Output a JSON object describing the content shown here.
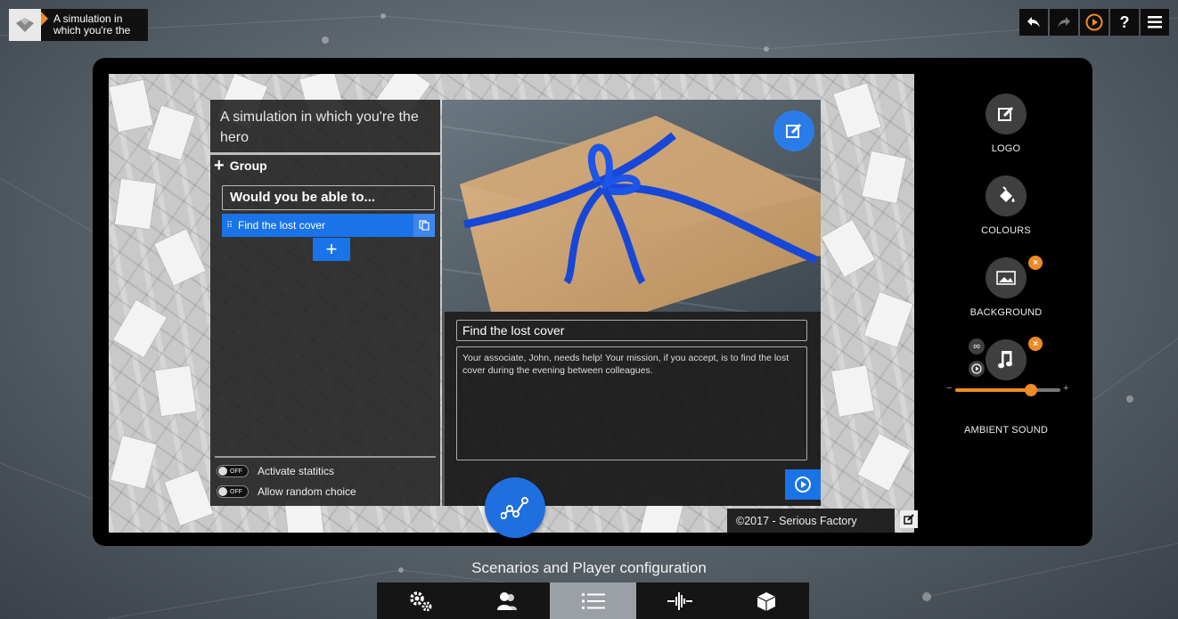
{
  "window": {
    "title": "A simulation in which you're the"
  },
  "toolbar": {
    "undo_icon": "undo-arrow-icon",
    "redo_icon": "redo-arrow-icon",
    "preview_icon": "play-circle-icon",
    "help_label": "?",
    "menu_icon": "hamburger-menu-icon"
  },
  "left_panel": {
    "title": "A simulation in which you're the hero",
    "group_button_label": "Group",
    "question_title": "Would you be able to...",
    "scenario_item_label": "Find the lost cover",
    "add_scenario_label": "+",
    "options": [
      {
        "toggle_text": "OFF",
        "label": "Activate statitics"
      },
      {
        "toggle_text": "OFF",
        "label": "Allow random choice"
      }
    ]
  },
  "content_panel": {
    "scenario_title": "Find the lost cover",
    "scenario_description": "Your associate, John, needs help! Your mission, if you accept, is to find the lost cover during the evening between colleagues."
  },
  "copyright": "©2017 - Serious Factory",
  "sidebar": {
    "logo_label": "LOGO",
    "colours_label": "COLOURS",
    "background_label": "BACKGROUND",
    "ambient_label": "AMBIENT SOUND",
    "remove_badge": "×",
    "loop_symbol": "∞",
    "volume_minus": "−",
    "volume_plus": "+",
    "volume_level": 0.72
  },
  "bottom": {
    "section_title": "Scenarios and Player configuration",
    "tabs": [
      {
        "icon": "gears-icon",
        "active": false
      },
      {
        "icon": "characters-icon",
        "active": false
      },
      {
        "icon": "list-icon",
        "active": true
      },
      {
        "icon": "sound-wave-icon",
        "active": false
      },
      {
        "icon": "cube-icon",
        "active": false
      }
    ]
  },
  "colors": {
    "accent_blue": "#1a73e8",
    "accent_orange": "#f08a24",
    "panel_dark": "#1e1e1e"
  }
}
